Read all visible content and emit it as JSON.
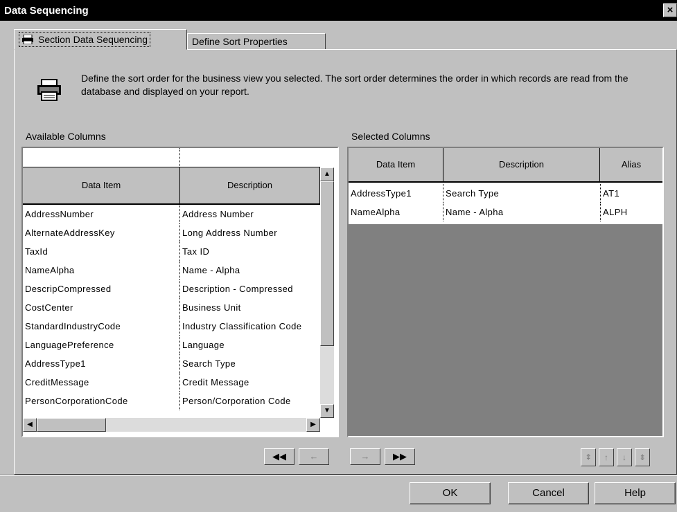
{
  "window": {
    "title": "Data Sequencing",
    "close_label": "×"
  },
  "tabs": [
    {
      "label": "Section Data Sequencing",
      "active": true,
      "icon": "printer-icon"
    },
    {
      "label": "Define Sort Properties",
      "active": false
    }
  ],
  "instructions": "Define the sort order for the business view you selected.  The sort order determines the order in which records are read from the database and displayed on your report.",
  "available": {
    "label": "Available Columns",
    "headers": {
      "data_item": "Data Item",
      "description": "Description"
    },
    "rows": [
      {
        "data_item": "AddressNumber",
        "description": "Address Number"
      },
      {
        "data_item": "AlternateAddressKey",
        "description": "Long Address Number"
      },
      {
        "data_item": "TaxId",
        "description": "Tax ID"
      },
      {
        "data_item": "NameAlpha",
        "description": "Name - Alpha"
      },
      {
        "data_item": "DescripCompressed",
        "description": "Description - Compressed"
      },
      {
        "data_item": "CostCenter",
        "description": "Business Unit"
      },
      {
        "data_item": "StandardIndustryCode",
        "description": "Industry Classification Code"
      },
      {
        "data_item": "LanguagePreference",
        "description": "Language"
      },
      {
        "data_item": "AddressType1",
        "description": "Search Type"
      },
      {
        "data_item": "CreditMessage",
        "description": "Credit Message"
      },
      {
        "data_item": "PersonCorporationCode",
        "description": "Person/Corporation Code"
      }
    ]
  },
  "selected": {
    "label": "Selected Columns",
    "headers": {
      "data_item": "Data Item",
      "description": "Description",
      "alias": "Alias"
    },
    "rows": [
      {
        "data_item": "AddressType1",
        "description": "Search Type",
        "alias": "AT1"
      },
      {
        "data_item": "NameAlpha",
        "description": "Name - Alpha",
        "alias": "ALPH"
      }
    ]
  },
  "move_buttons": {
    "remove_all": "◀◀",
    "remove": "←",
    "add": "→",
    "add_all": "▶▶"
  },
  "order_buttons": {
    "move_top": "⇞",
    "move_up": "↑",
    "move_down": "↓",
    "move_bottom": "⇟"
  },
  "dialog_buttons": {
    "ok": "OK",
    "cancel": "Cancel",
    "help": "Help"
  },
  "colors": {
    "titlebar": "#000000",
    "face": "#c0c0c0",
    "grid_empty": "#808080"
  }
}
